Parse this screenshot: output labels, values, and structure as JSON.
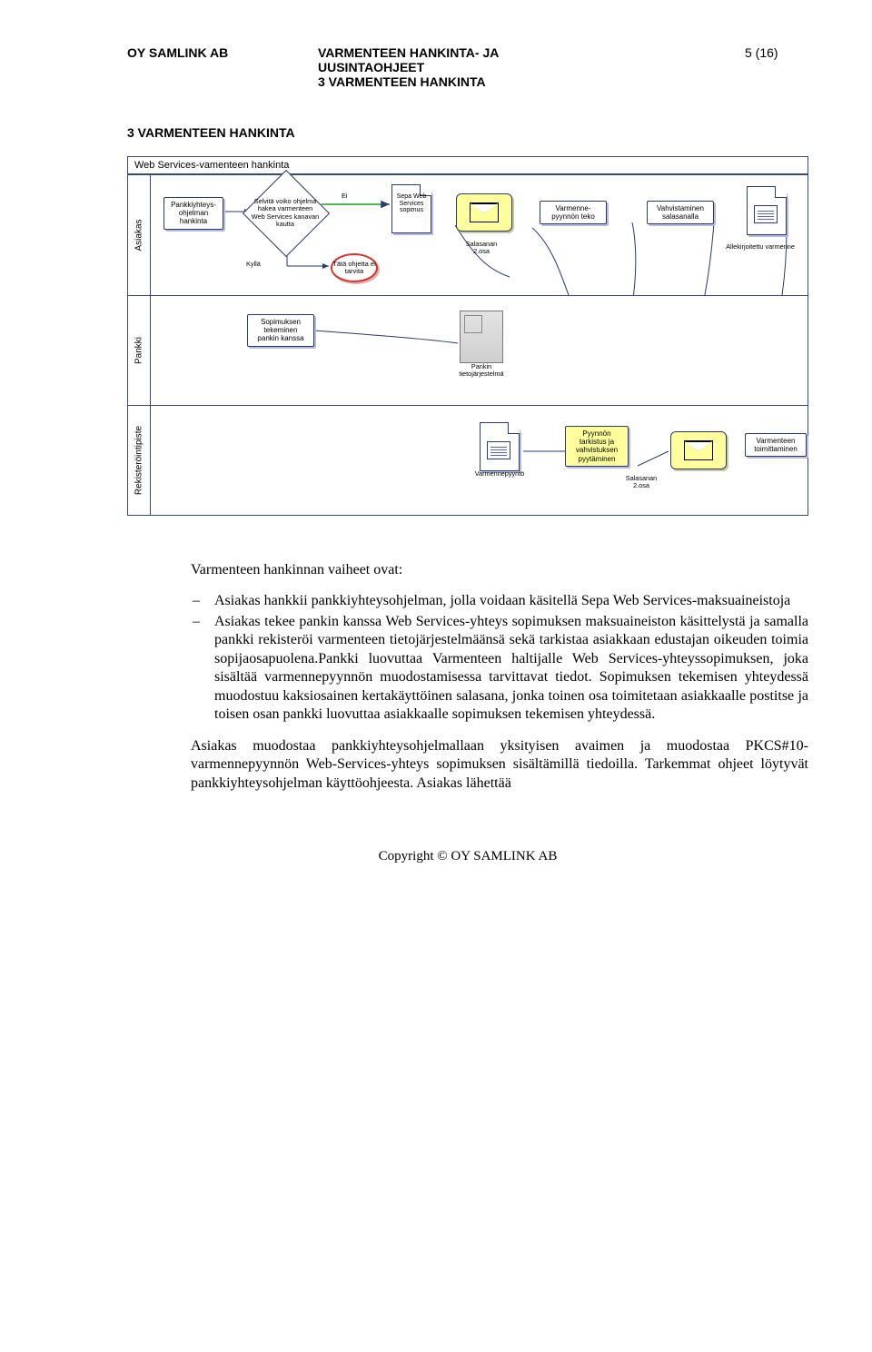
{
  "header": {
    "left": "OY SAMLINK AB",
    "mid_line1": "VARMENTEEN HANKINTA- JA",
    "mid_line2": "UUSINTAOHJEET",
    "mid_line3": "3 VARMENTEEN HANKINTA",
    "right": "5 (16)"
  },
  "section_title": "3 VARMENTEEN HANKINTA",
  "diagram": {
    "title": "Web Services-vamenteen hankinta",
    "lanes": {
      "asiakas": "Asiakas",
      "pankki": "Pankki",
      "rekisterointipiste": "Rekisteröintipiste"
    },
    "asiakas": {
      "pankkiyhteys": "Pankkiyhteys-\nohjelman\nhankinta",
      "selvita": "Selvitä voiko ohjelma\nhakea varmenteen\nWeb Services kanavan\nkautta",
      "ei": "Ei",
      "kylla": "Kyllä",
      "tata_ohjetta": "Tätä ohjetta ei\ntarvita",
      "sepa": "Sepa Web\nServices\nsopimus",
      "salasana_label": "Salasanan\n2.osa",
      "varmennepyynnon": "Varmenne-\npyynnön teko",
      "vahvistaminen": "Vahvistaminen\nsalasanalla",
      "allekirjoitettu": "Allekirjoitettu varmenne"
    },
    "pankki": {
      "sopimuksen": "Sopimuksen\ntekeminen\npankin kanssa",
      "pankin_tj": "Pankin\ntietojärjestelmä"
    },
    "rp": {
      "varmennepyynto": "Varmennepyyntö",
      "pyynnon": "Pyynnön\ntarkistus ja\nvahvistuksen\npyytäminen",
      "salasana": "Salasanan\n2.osa",
      "toimittaminen": "Varmenteen\ntoimittaminen"
    }
  },
  "body": {
    "lead": "Varmenteen hankinnan vaiheet ovat:",
    "b1": "Asiakas hankkii pankkiyhteysohjelman, jolla voidaan käsitellä Sepa Web Services-maksuaineistoja",
    "b2": "Asiakas tekee pankin kanssa Web Services-yhteys sopimuksen maksuaineiston käsittelystä ja samalla pankki rekisteröi varmenteen tietojärjestelmäänsä sekä tarkistaa asiakkaan edustajan oikeuden toimia sopijaosapuolena.Pankki luovuttaa Varmenteen haltijalle Web Services-yhteyssopimuksen, joka sisältää varmennepyynnön muodostamisessa tarvittavat tiedot. Sopimuksen tekemisen yhteydessä muodostuu kaksiosainen kertakäyttöinen salasana, jonka toinen osa toimitetaan asiakkaalle postitse ja toisen osan pankki luovuttaa asiakkaalle sopimuksen tekemisen yhteydessä.",
    "p2": "Asiakas muodostaa pankkiyhteysohjelmallaan yksityisen avaimen ja muodostaa PKCS#10-varmennepyynnön Web-Services-yhteys sopimuksen sisältämillä tiedoilla. Tarkemmat ohjeet löytyvät pankkiyhteysohjelman käyttöohjeesta. Asiakas lähettää"
  },
  "footer": "Copyright © OY SAMLINK AB"
}
